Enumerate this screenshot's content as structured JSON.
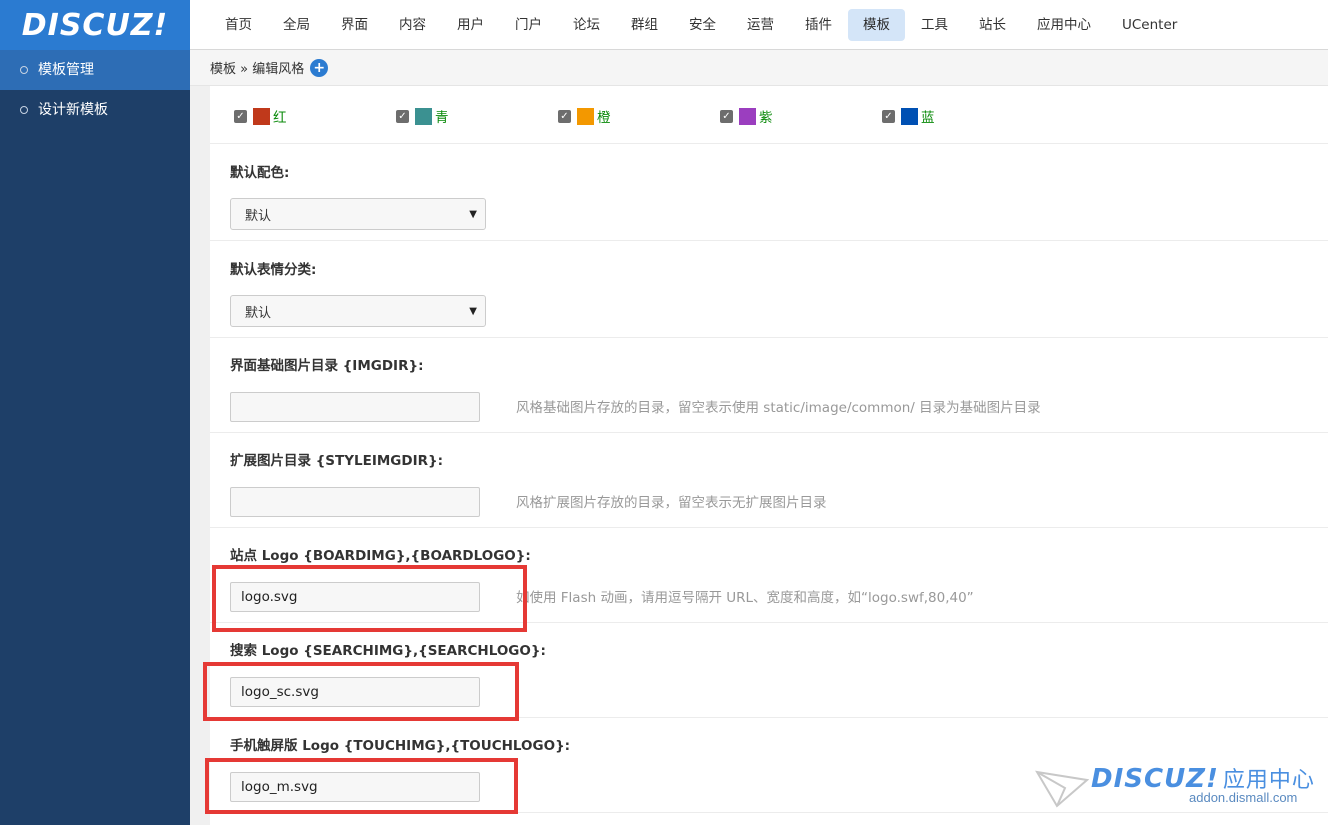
{
  "app": {
    "logo": "DISCUZ!"
  },
  "nav": [
    "首页",
    "全局",
    "界面",
    "内容",
    "用户",
    "门户",
    "论坛",
    "群组",
    "安全",
    "运营",
    "插件",
    "模板",
    "工具",
    "站长",
    "应用中心",
    "UCenter"
  ],
  "sidebar": {
    "items": [
      {
        "label": "模板管理",
        "active": true
      },
      {
        "label": "设计新模板",
        "active": false
      }
    ]
  },
  "breadcrumb": {
    "text": "模板 » 编辑风格",
    "add_icon": "plus-circle-icon"
  },
  "colors": [
    {
      "label": "红",
      "color": "#c0391b",
      "checked": true
    },
    {
      "label": "青",
      "color": "#3b9191",
      "checked": true
    },
    {
      "label": "橙",
      "color": "#f39800",
      "checked": true
    },
    {
      "label": "紫",
      "color": "#9b3ebf",
      "checked": true
    },
    {
      "label": "蓝",
      "color": "#0050b3",
      "checked": true
    }
  ],
  "fields": {
    "default_scheme": {
      "label": "默认配色:",
      "value": "默认"
    },
    "default_smiley": {
      "label": "默认表情分类:",
      "value": "默认"
    },
    "imgdir": {
      "label": "界面基础图片目录 {IMGDIR}:",
      "value": "",
      "hint": "风格基础图片存放的目录，留空表示使用 static/image/common/ 目录为基础图片目录"
    },
    "styleimgdir": {
      "label": "扩展图片目录 {STYLEIMGDIR}:",
      "value": "",
      "hint": "风格扩展图片存放的目录，留空表示无扩展图片目录"
    },
    "boardimg": {
      "label": "站点 Logo {BOARDIMG},{BOARDLOGO}:",
      "value": "logo.svg",
      "hint": "如使用 Flash 动画，请用逗号隔开 URL、宽度和高度，如“logo.swf,80,40”"
    },
    "searchimg": {
      "label": "搜索 Logo {SEARCHIMG},{SEARCHLOGO}:",
      "value": "logo_sc.svg"
    },
    "touchimg": {
      "label": "手机触屏版 Logo {TOUCHIMG},{TOUCHLOGO}:",
      "value": "logo_m.svg"
    }
  },
  "watermark": {
    "brand": "DISCUZ!",
    "brand_cn": "应用中心",
    "url": "addon.dismall.com"
  },
  "accent_colors": {
    "primary": "#2b7bd1",
    "sidebar": "#1e3f68",
    "highlight": "#e53935"
  }
}
